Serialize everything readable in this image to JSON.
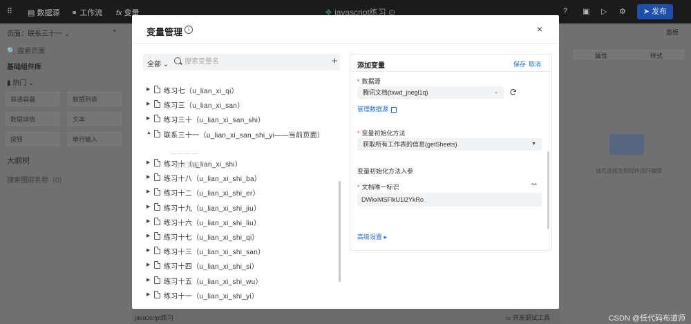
{
  "app": {
    "nav": {
      "datasource": "数据源",
      "workflow": "工作流",
      "variable": "变量"
    },
    "title": "javascript练习",
    "publish": "发布",
    "left": {
      "page": "页面：联系三十一",
      "search_placeholder": "搜索页面",
      "section1": "基础组件库",
      "hot": "热门",
      "components": [
        "普通容器",
        "数据列表",
        "数据详情",
        "文本",
        "按钮",
        "单行输入"
      ],
      "outline": "大纲树",
      "outline_search": "搜索图层名称（0）"
    },
    "right": {
      "config": "面板",
      "tab1": "属性",
      "tab2": "样式",
      "empty": "请先选择左侧组件进行编辑"
    },
    "bottom": {
      "left": "javascript练习",
      "right": "开发调试工具"
    },
    "watermark": "CSDN @低代码布道师"
  },
  "modal": {
    "title": "变量管理",
    "close": "×",
    "filter": "全部",
    "search_placeholder": "搜索变量名",
    "add": "+",
    "tree": [
      {
        "label": "练习七（u_lian_xi_qi）",
        "expanded": false
      },
      {
        "label": "练习三（u_lian_xi_san）",
        "expanded": false
      },
      {
        "label": "练习三十（u_lian_xi_san_shi）",
        "expanded": false
      },
      {
        "label": "联系三十一（u_lian_xi_san_shi_yi——当前页面）",
        "expanded": true
      },
      {
        "label": "练习十（u_lian_xi_shi）",
        "expanded": false
      },
      {
        "label": "练习十八（u_lian_xi_shi_ba）",
        "expanded": false
      },
      {
        "label": "练习十二（u_lian_xi_shi_er）",
        "expanded": false
      },
      {
        "label": "练习十九（u_lian_xi_shi_jiu）",
        "expanded": false
      },
      {
        "label": "练习十六（u_lian_xi_shi_liu）",
        "expanded": false
      },
      {
        "label": "练习十七（u_lian_xi_shi_qi）",
        "expanded": false
      },
      {
        "label": "练习十三（u_lian_xi_shi_san）",
        "expanded": false
      },
      {
        "label": "练习十四（u_lian_xi_shi_si）",
        "expanded": false
      },
      {
        "label": "练习十五（u_lian_xi_shi_wu）",
        "expanded": false
      },
      {
        "label": "练习十一（u_lian_xi_shi_yi）",
        "expanded": false
      }
    ],
    "tree_empty": "暂无变量",
    "form": {
      "title": "添加变量",
      "save": "保存",
      "cancel": "取消",
      "datasource_label": "数据源",
      "datasource_value": "腾讯文档(txwd_jnegl1q)",
      "manage_link": "管理数据源",
      "init_method_label": "变量初始化方法",
      "init_method_value": "获取所有工作表的信息(getSheets)",
      "params_section": "变量初始化方法入参",
      "doc_id_label": "文档唯一标识",
      "doc_id_value": "DWkxMSFlkU1l2YkRo",
      "advanced": "高级设置"
    }
  }
}
